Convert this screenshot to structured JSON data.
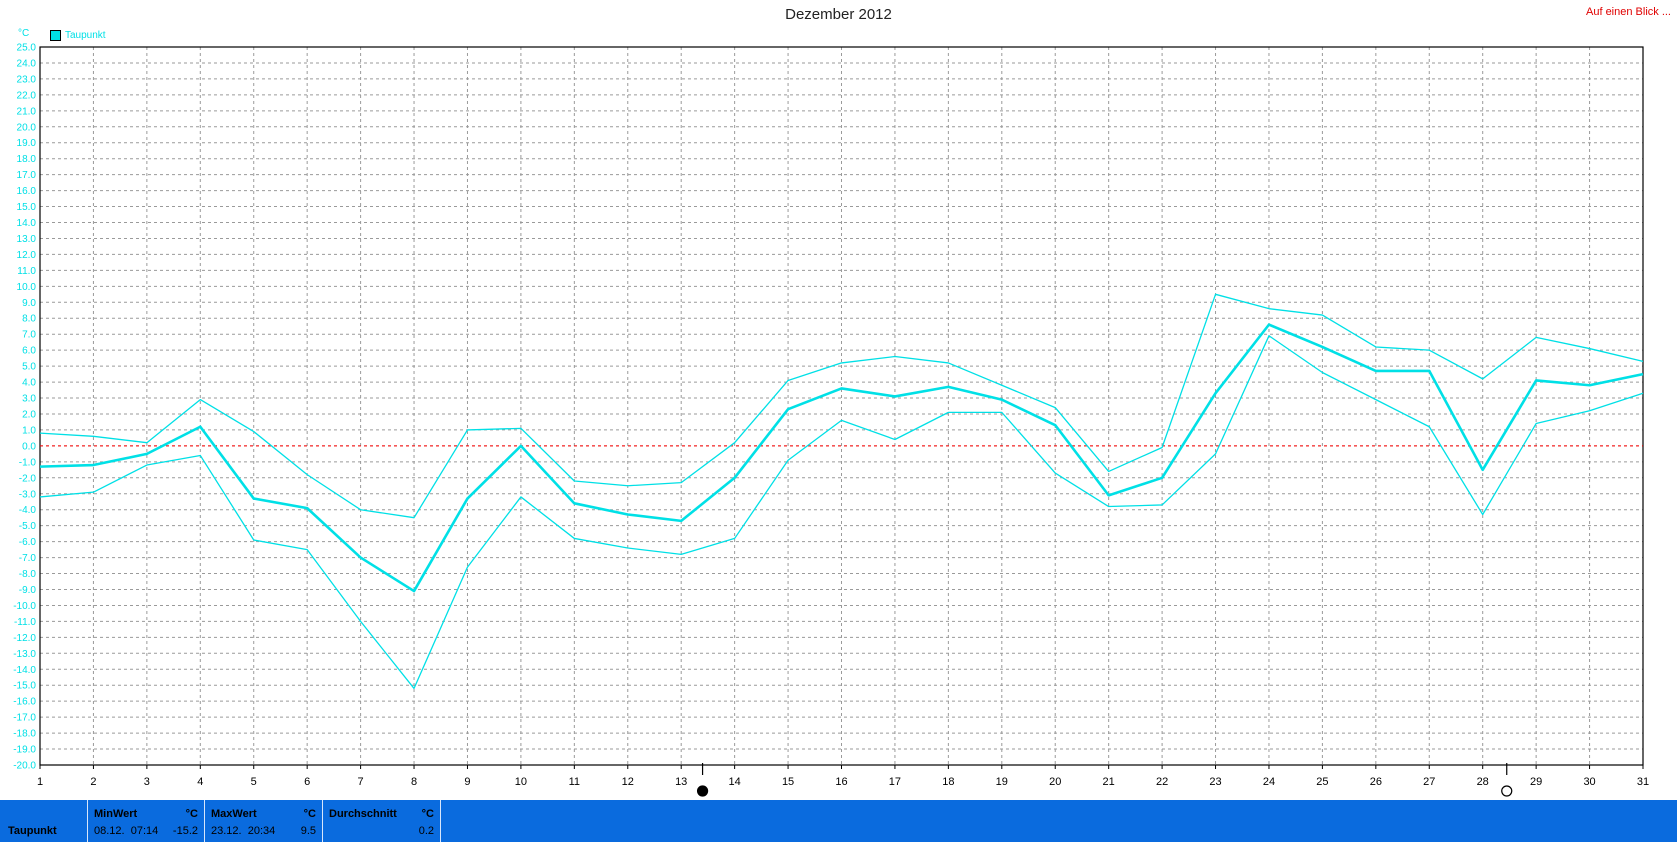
{
  "header": {
    "title": "Dezember 2012",
    "link_label": "Auf einen Blick ..."
  },
  "colors": {
    "series": "#00e0e6",
    "zero_line": "#ff0000",
    "grid": "#9a9a9a",
    "statusbar": "#0a6bde",
    "link": "#e00000"
  },
  "chart_data": {
    "type": "line",
    "title": "Dezember 2012",
    "unit_label": "°C",
    "legend": [
      "Taupunkt"
    ],
    "legend_position": "top-left",
    "x": [
      1,
      2,
      3,
      4,
      5,
      6,
      7,
      8,
      9,
      10,
      11,
      12,
      13,
      14,
      15,
      16,
      17,
      18,
      19,
      20,
      21,
      22,
      23,
      24,
      25,
      26,
      27,
      28,
      29,
      30,
      31
    ],
    "xlim": [
      1,
      31
    ],
    "ylim": [
      -20,
      25
    ],
    "y_tick_step": 1,
    "grid": true,
    "reference_line": 0,
    "series": [
      {
        "role": "max",
        "values": [
          0.8,
          0.6,
          0.2,
          2.9,
          0.9,
          -1.8,
          -4.0,
          -4.5,
          1.0,
          1.1,
          -2.2,
          -2.5,
          -2.3,
          0.2,
          4.1,
          5.2,
          5.6,
          5.2,
          3.8,
          2.4,
          -1.6,
          -0.1,
          9.5,
          8.6,
          8.2,
          6.2,
          6.0,
          4.2,
          6.8,
          6.1,
          5.3
        ]
      },
      {
        "role": "mean",
        "values": [
          -1.3,
          -1.2,
          -0.5,
          1.2,
          -3.3,
          -3.9,
          -7.0,
          -9.1,
          -3.3,
          0.0,
          -3.6,
          -4.3,
          -4.7,
          -2.0,
          2.3,
          3.6,
          3.1,
          3.7,
          2.9,
          1.3,
          -3.1,
          -2.0,
          3.3,
          7.6,
          6.2,
          4.7,
          4.7,
          -1.5,
          4.1,
          3.8,
          4.5
        ]
      },
      {
        "role": "min",
        "values": [
          -3.2,
          -2.9,
          -1.2,
          -0.6,
          -5.9,
          -6.5,
          -11.0,
          -15.2,
          -7.6,
          -3.2,
          -5.8,
          -6.4,
          -6.8,
          -5.8,
          -0.9,
          1.6,
          0.4,
          2.1,
          2.1,
          -1.7,
          -3.8,
          -3.7,
          -0.5,
          6.9,
          4.6,
          2.9,
          1.2,
          -4.3,
          1.4,
          2.2,
          3.3
        ]
      }
    ],
    "moon_markers": [
      {
        "day": 13.4,
        "phase": "new"
      },
      {
        "day": 28.45,
        "phase": "full"
      }
    ]
  },
  "statusbar": {
    "row_label": "Taupunkt",
    "min": {
      "header": "MinWert",
      "unit": "°C",
      "date": "08.12.",
      "time": "07:14",
      "value": "-15.2"
    },
    "max": {
      "header": "MaxWert",
      "unit": "°C",
      "date": "23.12.",
      "time": "20:34",
      "value": "9.5"
    },
    "avg": {
      "header": "Durchschnitt",
      "unit": "°C",
      "value": "0.2"
    }
  }
}
